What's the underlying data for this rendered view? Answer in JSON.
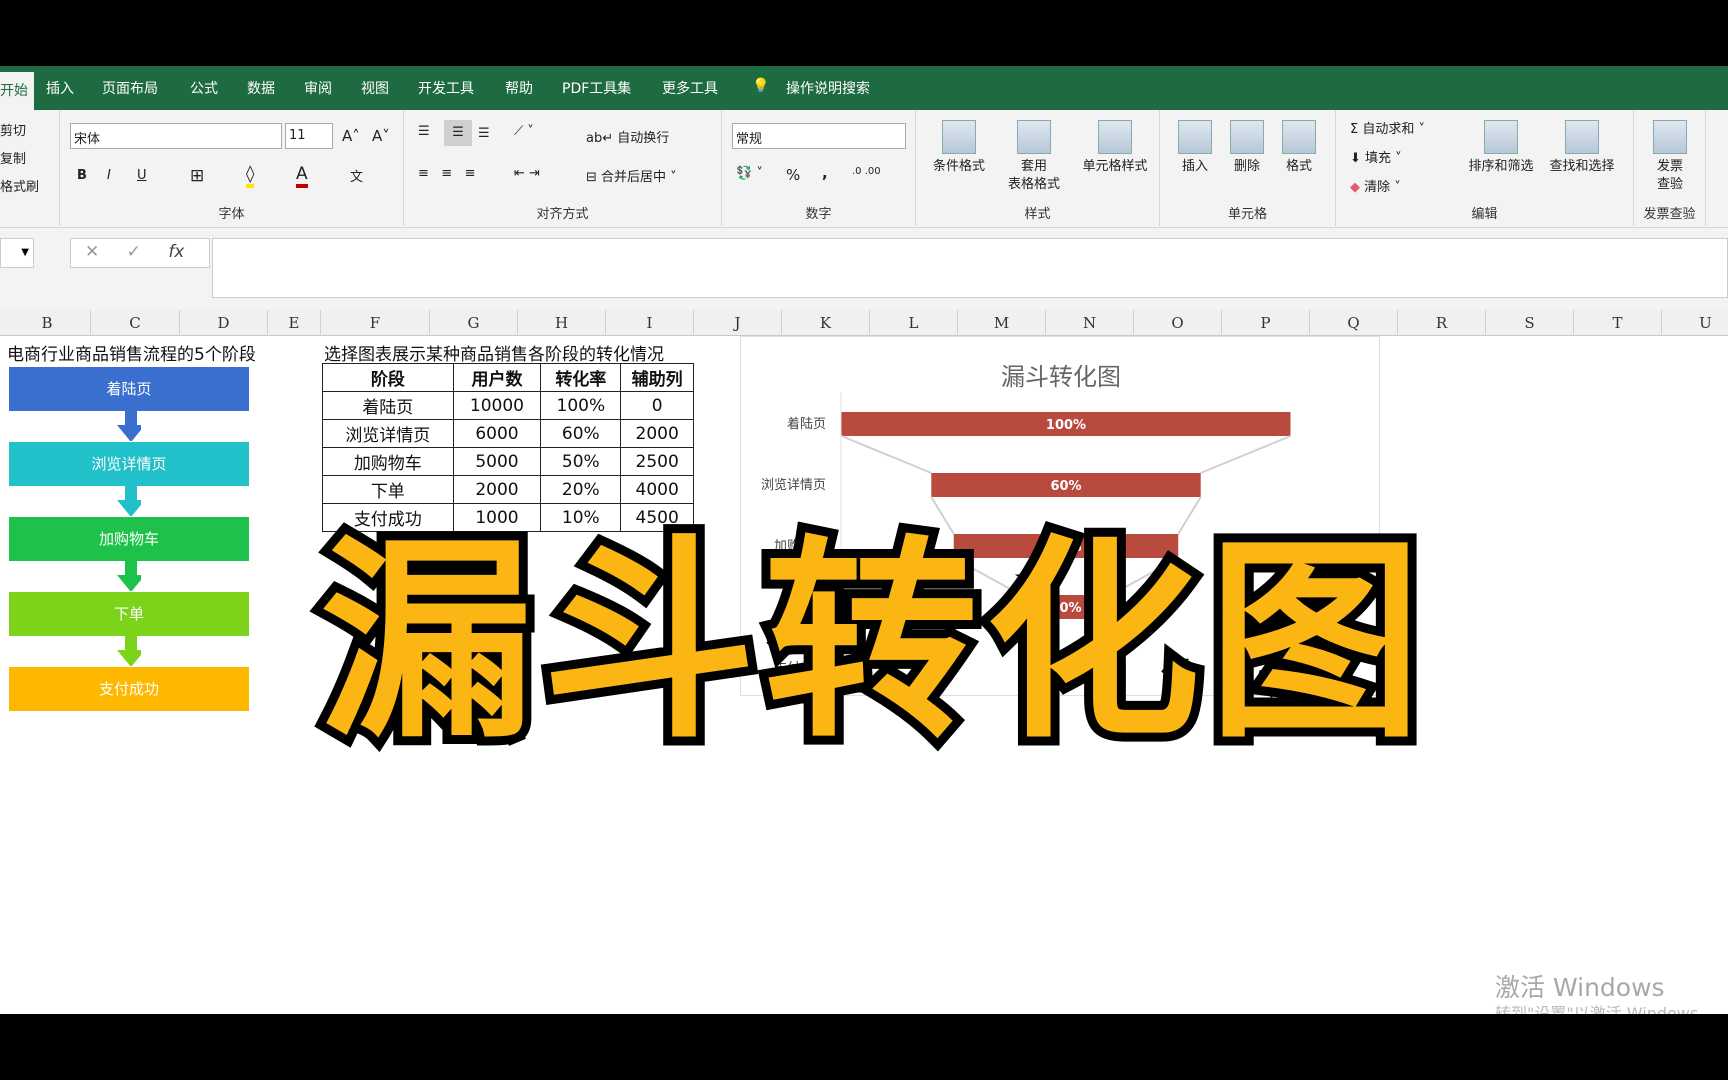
{
  "tabs": [
    "开始",
    "插入",
    "页面布局",
    "公式",
    "数据",
    "审阅",
    "视图",
    "开发工具",
    "帮助",
    "PDF工具集",
    "更多工具",
    "操作说明搜索"
  ],
  "clipboard": [
    "剪切",
    "复制",
    "格式刷"
  ],
  "font": {
    "name": "宋体",
    "size": "11",
    "group": "字体",
    "bold": "B",
    "italic": "I",
    "underline": "U"
  },
  "align": {
    "wrap": "自动换行",
    "merge": "合并后居中",
    "group": "对齐方式"
  },
  "number": {
    "format": "常规",
    "percent": "%",
    "comma": ",",
    "group": "数字"
  },
  "styles": {
    "cond": "条件格式",
    "table1": "套用",
    "table2": "表格格式",
    "cell": "单元格样式",
    "group": "样式"
  },
  "cells": {
    "insert": "插入",
    "delete": "删除",
    "format": "格式",
    "group": "单元格"
  },
  "edit": {
    "autosum": "自动求和",
    "fill": "填充",
    "clear": "清除",
    "sort": "排序和筛选",
    "find": "查找和选择",
    "group": "编辑"
  },
  "invoice": {
    "btn1": "发票",
    "btn2": "查验",
    "group": "发票查验"
  },
  "formula": {
    "cancel": "✕",
    "enter": "✓",
    "fx": "fx",
    "value": ""
  },
  "columns": [
    "B",
    "C",
    "D",
    "E",
    "F",
    "G",
    "H",
    "I",
    "J",
    "K",
    "L",
    "M",
    "N",
    "O",
    "P",
    "Q",
    "R",
    "S",
    "T",
    "U"
  ],
  "flow": {
    "title": "电商行业商品销售流程的5个阶段",
    "steps": [
      {
        "label": "着陆页",
        "color": "#3a6fcf"
      },
      {
        "label": "浏览详情页",
        "color": "#22c0c8"
      },
      {
        "label": "加购物车",
        "color": "#1ec24b"
      },
      {
        "label": "下单",
        "color": "#7dd31a"
      },
      {
        "label": "支付成功",
        "color": "#ffb800"
      }
    ]
  },
  "table": {
    "title": "选择图表展示某种商品销售各阶段的转化情况",
    "headers": [
      "阶段",
      "用户数",
      "转化率",
      "辅助列"
    ],
    "rows": [
      [
        "着陆页",
        "10000",
        "100%",
        "0"
      ],
      [
        "浏览详情页",
        "6000",
        "60%",
        "2000"
      ],
      [
        "加购物车",
        "5000",
        "50%",
        "2500"
      ],
      [
        "下单",
        "2000",
        "20%",
        "4000"
      ],
      [
        "支付成功",
        "1000",
        "10%",
        "4500"
      ]
    ]
  },
  "chart_data": {
    "type": "bar",
    "subtype": "funnel",
    "title": "漏斗转化图",
    "categories": [
      "着陆页",
      "浏览详情页",
      "加购物车",
      "下单",
      "支付成功"
    ],
    "values": [
      10000,
      6000,
      5000,
      2000,
      1000
    ],
    "helper": [
      0,
      2000,
      2500,
      4000,
      4500
    ],
    "labels": [
      "100%",
      "60%",
      "50%",
      "20%",
      "10%"
    ],
    "bar_color": "#b94a3e",
    "xlim": [
      0,
      10000
    ]
  },
  "overlay_title": "漏斗转化图",
  "watermark": {
    "line1": "激活 Windows",
    "line2": "转到\"设置\"以激活 Windows。"
  }
}
